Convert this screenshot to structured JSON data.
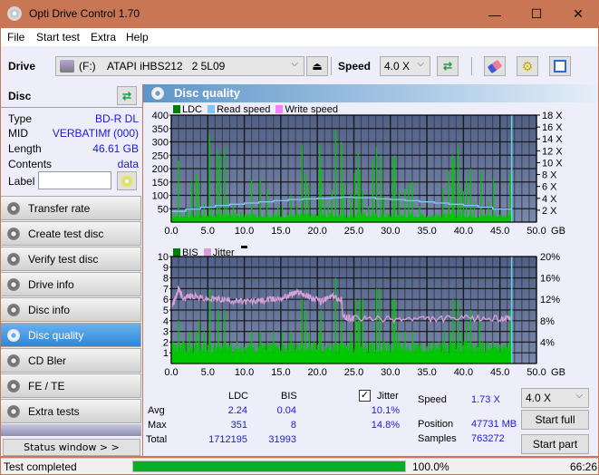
{
  "window": {
    "title": "Opti Drive Control 1.70",
    "controls": {
      "minimize": "—",
      "maximize": "☐",
      "close": "✕"
    }
  },
  "menu": [
    "File",
    "Start test",
    "Extra",
    "Help"
  ],
  "toolbar": {
    "drive_label": "Drive",
    "drive_letter": "(F:)",
    "drive_name": "ATAPI iHBS212   2 5L09",
    "speed_label": "Speed",
    "speed_value": "4.0 X",
    "icons": [
      "eject-icon",
      "refresh-icon",
      "erase-icon",
      "settings-icon",
      "save-icon"
    ]
  },
  "disc": {
    "header": "Disc",
    "fields": [
      {
        "key": "Type",
        "value": "BD-R DL"
      },
      {
        "key": "MID",
        "value": "VERBATIMf (000)"
      },
      {
        "key": "Length",
        "value": "46.61 GB"
      },
      {
        "key": "Contents",
        "value": "data"
      }
    ],
    "label_key": "Label",
    "label_value": ""
  },
  "nav": [
    {
      "label": "Transfer rate",
      "active": false
    },
    {
      "label": "Create test disc",
      "active": false
    },
    {
      "label": "Verify test disc",
      "active": false
    },
    {
      "label": "Drive info",
      "active": false
    },
    {
      "label": "Disc info",
      "active": false
    },
    {
      "label": "Disc quality",
      "active": true
    },
    {
      "label": "CD Bler",
      "active": false
    },
    {
      "label": "FE / TE",
      "active": false
    },
    {
      "label": "Extra tests",
      "active": false
    }
  ],
  "status_window_button": "Status window > >",
  "panel_title": "Disc quality",
  "colors": {
    "ldc": "#008000",
    "ldc_bar": "#00c800",
    "read_speed": "#7fc6f4",
    "write_speed": "#ff80ff",
    "jitter": "#d8a0d8",
    "bis": "#008000",
    "plot_bg_top": "#4f5f86",
    "plot_bg_bottom": "#7a8aae",
    "value_text": "#1a1adc"
  },
  "chart_data": [
    {
      "type": "bar",
      "title": "LDC",
      "legend": [
        "LDC",
        "Read speed",
        "Write speed"
      ],
      "xlabel": "GB",
      "x_ticks": [
        "0.0",
        "5.0",
        "10.0",
        "15.0",
        "20.0",
        "25.0",
        "30.0",
        "35.0",
        "40.0",
        "45.0",
        "50.0"
      ],
      "xlim": [
        0,
        50
      ],
      "y_left_ticks": [
        "50",
        "100",
        "150",
        "200",
        "250",
        "300",
        "350",
        "400"
      ],
      "ylim_left": [
        0,
        400
      ],
      "y_right_ticks": [
        "2 X",
        "4 X",
        "6 X",
        "8 X",
        "10 X",
        "12 X",
        "14 X",
        "16 X",
        "18 X"
      ],
      "ylim_right": [
        0,
        18
      ],
      "grid": true,
      "end_marker_gb": 46.61,
      "ldc_peaks": [
        [
          1.0,
          230
        ],
        [
          2.2,
          50
        ],
        [
          2.8,
          150
        ],
        [
          3.4,
          180
        ],
        [
          3.7,
          160
        ],
        [
          4.5,
          70
        ],
        [
          5.2,
          330
        ],
        [
          5.5,
          50
        ],
        [
          6.3,
          270
        ],
        [
          6.6,
          250
        ],
        [
          7.3,
          280
        ],
        [
          7.6,
          90
        ],
        [
          8.5,
          60
        ],
        [
          9.5,
          40
        ],
        [
          11.0,
          155
        ],
        [
          12.2,
          160
        ],
        [
          13.1,
          120
        ],
        [
          14.6,
          60
        ],
        [
          15.2,
          55
        ],
        [
          16.4,
          100
        ],
        [
          17.2,
          60
        ],
        [
          17.9,
          290
        ],
        [
          18.4,
          180
        ],
        [
          18.8,
          140
        ],
        [
          20.3,
          285
        ],
        [
          20.5,
          200
        ],
        [
          21.0,
          90
        ],
        [
          21.5,
          60
        ],
        [
          22.0,
          120
        ],
        [
          22.5,
          345
        ],
        [
          23.3,
          300
        ],
        [
          23.6,
          140
        ],
        [
          24.6,
          110
        ],
        [
          25.1,
          185
        ],
        [
          25.6,
          260
        ],
        [
          25.8,
          190
        ],
        [
          26.2,
          120
        ],
        [
          27.0,
          60
        ],
        [
          27.6,
          230
        ],
        [
          28.1,
          280
        ],
        [
          28.7,
          250
        ],
        [
          29.1,
          90
        ],
        [
          30.4,
          240
        ],
        [
          30.6,
          250
        ],
        [
          31.2,
          115
        ],
        [
          32.0,
          125
        ],
        [
          32.5,
          145
        ],
        [
          33.0,
          150
        ],
        [
          34.0,
          60
        ],
        [
          37.2,
          130
        ],
        [
          38.0,
          190
        ],
        [
          38.5,
          250
        ],
        [
          38.7,
          230
        ],
        [
          39.3,
          280
        ],
        [
          39.6,
          130
        ],
        [
          40.0,
          115
        ],
        [
          40.4,
          160
        ],
        [
          41.0,
          200
        ],
        [
          41.5,
          75
        ],
        [
          42.4,
          190
        ],
        [
          43.4,
          80
        ],
        [
          44.1,
          160
        ],
        [
          46.4,
          185
        ]
      ],
      "ldc_baseline": 15,
      "read_speed_x": [
        0,
        2,
        4,
        6,
        8,
        10,
        12,
        14,
        16,
        18,
        20,
        22,
        23.3,
        25,
        28,
        30,
        32,
        34,
        36,
        38,
        40,
        42,
        44,
        46.61
      ],
      "read_speed_y": [
        1.8,
        2.2,
        2.5,
        2.8,
        3.0,
        3.2,
        3.4,
        3.6,
        3.8,
        3.9,
        4.0,
        4.1,
        4.2,
        4.1,
        3.9,
        3.8,
        3.6,
        3.4,
        3.2,
        3.0,
        2.8,
        2.5,
        2.2,
        1.73
      ]
    },
    {
      "type": "bar",
      "title": "BIS",
      "legend": [
        "BIS",
        "Jitter"
      ],
      "xlabel": "GB",
      "x_ticks": [
        "0.0",
        "5.0",
        "10.0",
        "15.0",
        "20.0",
        "25.0",
        "30.0",
        "35.0",
        "40.0",
        "45.0",
        "50.0"
      ],
      "xlim": [
        0,
        50
      ],
      "y_left_ticks": [
        "1",
        "2",
        "3",
        "4",
        "5",
        "6",
        "7",
        "8",
        "9",
        "10"
      ],
      "ylim_left": [
        0,
        10
      ],
      "y_right_ticks": [
        "4%",
        "8%",
        "12%",
        "16%",
        "20%"
      ],
      "ylim_right": [
        0,
        20
      ],
      "grid": true,
      "end_marker_gb": 46.61,
      "bis_peaks": [
        [
          1.0,
          4
        ],
        [
          2.5,
          3
        ],
        [
          3.4,
          3
        ],
        [
          3.8,
          4
        ],
        [
          4.5,
          3
        ],
        [
          5.3,
          7
        ],
        [
          6.4,
          5
        ],
        [
          7.3,
          5
        ],
        [
          8.2,
          2
        ],
        [
          9.0,
          2
        ],
        [
          11.0,
          3
        ],
        [
          12.2,
          3
        ],
        [
          14.0,
          3
        ],
        [
          15.2,
          3
        ],
        [
          16.4,
          3
        ],
        [
          17.9,
          6
        ],
        [
          18.4,
          5
        ],
        [
          18.9,
          3
        ],
        [
          20.3,
          3
        ],
        [
          20.5,
          5
        ],
        [
          22.5,
          8
        ],
        [
          23.3,
          4
        ],
        [
          24.6,
          3
        ],
        [
          25.2,
          6
        ],
        [
          25.6,
          4
        ],
        [
          25.8,
          6
        ],
        [
          26.2,
          6
        ],
        [
          27.5,
          2
        ],
        [
          28.1,
          7
        ],
        [
          28.5,
          7
        ],
        [
          29.0,
          2
        ],
        [
          30.4,
          6
        ],
        [
          30.6,
          6
        ],
        [
          31.0,
          3
        ],
        [
          32.0,
          3
        ],
        [
          33.0,
          3
        ],
        [
          37.4,
          3
        ],
        [
          38.2,
          3
        ],
        [
          38.6,
          6
        ],
        [
          39.3,
          6
        ],
        [
          39.8,
          3
        ],
        [
          40.4,
          4
        ],
        [
          41.0,
          5
        ],
        [
          42.2,
          4
        ],
        [
          43.3,
          2
        ],
        [
          46.4,
          5
        ]
      ],
      "bis_baseline": 1,
      "jitter_x": [
        0,
        0.5,
        1.0,
        1.5,
        3,
        5,
        7,
        9,
        11,
        13,
        15,
        16.5,
        17.5,
        19,
        20.5,
        22,
        23.3,
        23.5,
        25,
        30,
        35,
        40,
        45,
        46.61
      ],
      "jitter_y": [
        10.5,
        12.0,
        14.0,
        12.4,
        12.6,
        12.0,
        12.0,
        11.6,
        11.6,
        11.8,
        12.2,
        13.0,
        13.4,
        12.4,
        11.6,
        12.6,
        12.0,
        8.6,
        8.4,
        8.3,
        8.3,
        8.4,
        8.4,
        8.3
      ]
    }
  ],
  "stats": {
    "headers": {
      "ldc": "LDC",
      "bis": "BIS",
      "jitter": "Jitter"
    },
    "jitter_checked": true,
    "rows": [
      {
        "label": "Avg",
        "ldc": "2.24",
        "bis": "0.04",
        "jitter": "10.1%"
      },
      {
        "label": "Max",
        "ldc": "351",
        "bis": "8",
        "jitter": "14.8%"
      },
      {
        "label": "Total",
        "ldc": "1712195",
        "bis": "31993",
        "jitter": ""
      }
    ],
    "speed_label": "Speed",
    "speed_value": "1.73 X",
    "position_label": "Position",
    "position_value": "47731 MB",
    "samples_label": "Samples",
    "samples_value": "763272",
    "speed_select": "4.0 X",
    "start_full": "Start full",
    "start_part": "Start part"
  },
  "statusbar": {
    "status": "Test completed",
    "progress": 100.0,
    "progress_text": "100.0%",
    "time": "66:26"
  }
}
